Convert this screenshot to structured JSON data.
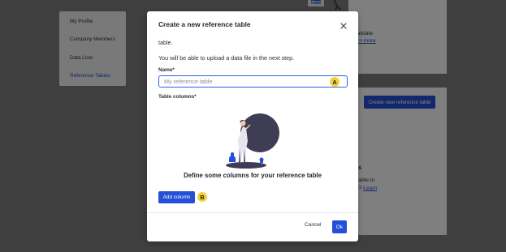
{
  "sidebar": {
    "items": [
      {
        "label": "My Profile"
      },
      {
        "label": "Company Members"
      },
      {
        "label": "Data Lists"
      },
      {
        "label": "Reference Tables"
      }
    ]
  },
  "background": {
    "validate_text": "to validate",
    "learn_more": "Learn more",
    "create_button": "Create new reference table",
    "heading": "bles",
    "line1": "ce table to",
    "line2": "ons?",
    "learn": "Learn"
  },
  "modal": {
    "title": "Create a new reference table",
    "cut_text": "table.",
    "upload_text": "You will be able to upload a data file in the next step.",
    "name_label": "Name*",
    "name_placeholder": "My reference table",
    "columns_label": "Table columns*",
    "empty_state_text": "Define some columns for your reference table",
    "add_column_label": "Add column",
    "cancel_label": "Cancel",
    "ok_label": "Ok"
  },
  "markers": {
    "a": "A",
    "b": "B"
  },
  "colors": {
    "primary": "#2450d8",
    "marker": "#f2d23a",
    "illustration": "#3f3d56"
  }
}
